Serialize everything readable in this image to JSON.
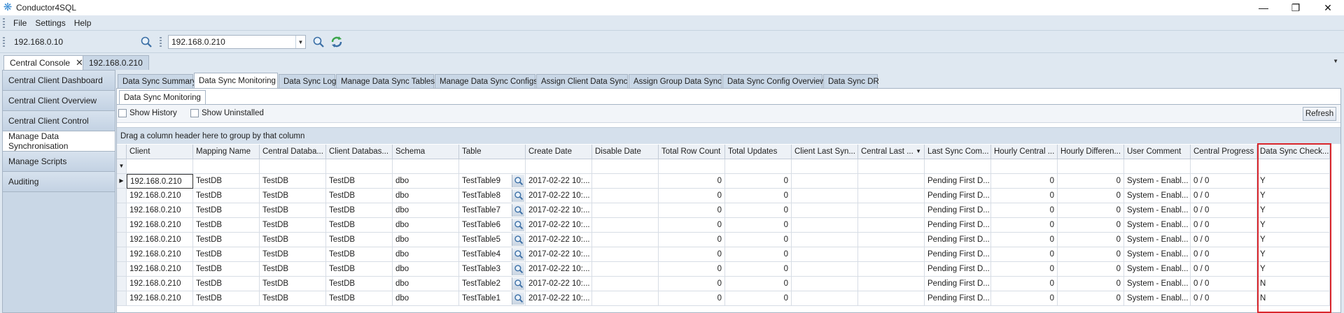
{
  "app": {
    "title": "Conductor4SQL"
  },
  "menu": [
    "File",
    "Settings",
    "Help"
  ],
  "toolbar": {
    "server_label": "192.168.0.10",
    "server_combo_value": "192.168.0.210"
  },
  "doc_tabs": [
    {
      "label": "Central Console",
      "active": true,
      "closable": true
    },
    {
      "label": "192.168.0.210",
      "active": false
    }
  ],
  "sidebar": {
    "items": [
      {
        "label": "Central Client Dashboard"
      },
      {
        "label": "Central Client Overview"
      },
      {
        "label": "Central Client Control"
      },
      {
        "label": "Manage Data Synchronisation",
        "active": true
      },
      {
        "label": "Manage Scripts"
      },
      {
        "label": "Auditing"
      }
    ]
  },
  "sub_tabs": [
    {
      "label": "Data Sync Summary"
    },
    {
      "label": "Data Sync Monitoring",
      "active": true
    },
    {
      "label": "Data Sync Log"
    },
    {
      "label": "Manage Data Sync Tables"
    },
    {
      "label": "Manage Data Sync Configs"
    },
    {
      "label": "Assign Client Data Sync"
    },
    {
      "label": "Assign Group Data Sync"
    },
    {
      "label": "Data Sync Config Overview"
    },
    {
      "label": "Data Sync DR"
    }
  ],
  "inner_tab": {
    "label": "Data Sync Monitoring"
  },
  "filters": {
    "show_history": "Show History",
    "show_uninstalled": "Show Uninstalled",
    "refresh": "Refresh"
  },
  "group_panel": {
    "text": "Drag a column header here to group by that column"
  },
  "grid": {
    "columns": [
      "Client",
      "Mapping Name",
      "Central Databa...",
      "Client Databas...",
      "Schema",
      "Table",
      "Create Date",
      "Disable Date",
      "Total Row Count",
      "Total Updates",
      "Client Last Syn...",
      "Central Last ...",
      "Last Sync Com...",
      "Hourly Central ...",
      "Hourly Differen...",
      "User Comment",
      "Central Progress",
      "Data Sync Check..."
    ],
    "rows": [
      [
        "192.168.0.210",
        "TestDB",
        "TestDB",
        "TestDB",
        "dbo",
        "TestTable9",
        "2017-02-22 10:...",
        "",
        "0",
        "0",
        "",
        "",
        "Pending First D...",
        "0",
        "0",
        "System - Enabl...",
        "0 / 0",
        "Y"
      ],
      [
        "192.168.0.210",
        "TestDB",
        "TestDB",
        "TestDB",
        "dbo",
        "TestTable8",
        "2017-02-22 10:...",
        "",
        "0",
        "0",
        "",
        "",
        "Pending First D...",
        "0",
        "0",
        "System - Enabl...",
        "0 / 0",
        "Y"
      ],
      [
        "192.168.0.210",
        "TestDB",
        "TestDB",
        "TestDB",
        "dbo",
        "TestTable7",
        "2017-02-22 10:...",
        "",
        "0",
        "0",
        "",
        "",
        "Pending First D...",
        "0",
        "0",
        "System - Enabl...",
        "0 / 0",
        "Y"
      ],
      [
        "192.168.0.210",
        "TestDB",
        "TestDB",
        "TestDB",
        "dbo",
        "TestTable6",
        "2017-02-22 10:...",
        "",
        "0",
        "0",
        "",
        "",
        "Pending First D...",
        "0",
        "0",
        "System - Enabl...",
        "0 / 0",
        "Y"
      ],
      [
        "192.168.0.210",
        "TestDB",
        "TestDB",
        "TestDB",
        "dbo",
        "TestTable5",
        "2017-02-22 10:...",
        "",
        "0",
        "0",
        "",
        "",
        "Pending First D...",
        "0",
        "0",
        "System - Enabl...",
        "0 / 0",
        "Y"
      ],
      [
        "192.168.0.210",
        "TestDB",
        "TestDB",
        "TestDB",
        "dbo",
        "TestTable4",
        "2017-02-22 10:...",
        "",
        "0",
        "0",
        "",
        "",
        "Pending First D...",
        "0",
        "0",
        "System - Enabl...",
        "0 / 0",
        "Y"
      ],
      [
        "192.168.0.210",
        "TestDB",
        "TestDB",
        "TestDB",
        "dbo",
        "TestTable3",
        "2017-02-22 10:...",
        "",
        "0",
        "0",
        "",
        "",
        "Pending First D...",
        "0",
        "0",
        "System - Enabl...",
        "0 / 0",
        "Y"
      ],
      [
        "192.168.0.210",
        "TestDB",
        "TestDB",
        "TestDB",
        "dbo",
        "TestTable2",
        "2017-02-22 10:...",
        "",
        "0",
        "0",
        "",
        "",
        "Pending First D...",
        "0",
        "0",
        "System - Enabl...",
        "0 / 0",
        "N"
      ],
      [
        "192.168.0.210",
        "TestDB",
        "TestDB",
        "TestDB",
        "dbo",
        "TestTable1",
        "2017-02-22 10:...",
        "",
        "0",
        "0",
        "",
        "",
        "Pending First D...",
        "0",
        "0",
        "System - Enabl...",
        "0 / 0",
        "N"
      ]
    ]
  },
  "colors": {
    "highlight": "#d9262c",
    "accent": "#3c8fd6"
  }
}
